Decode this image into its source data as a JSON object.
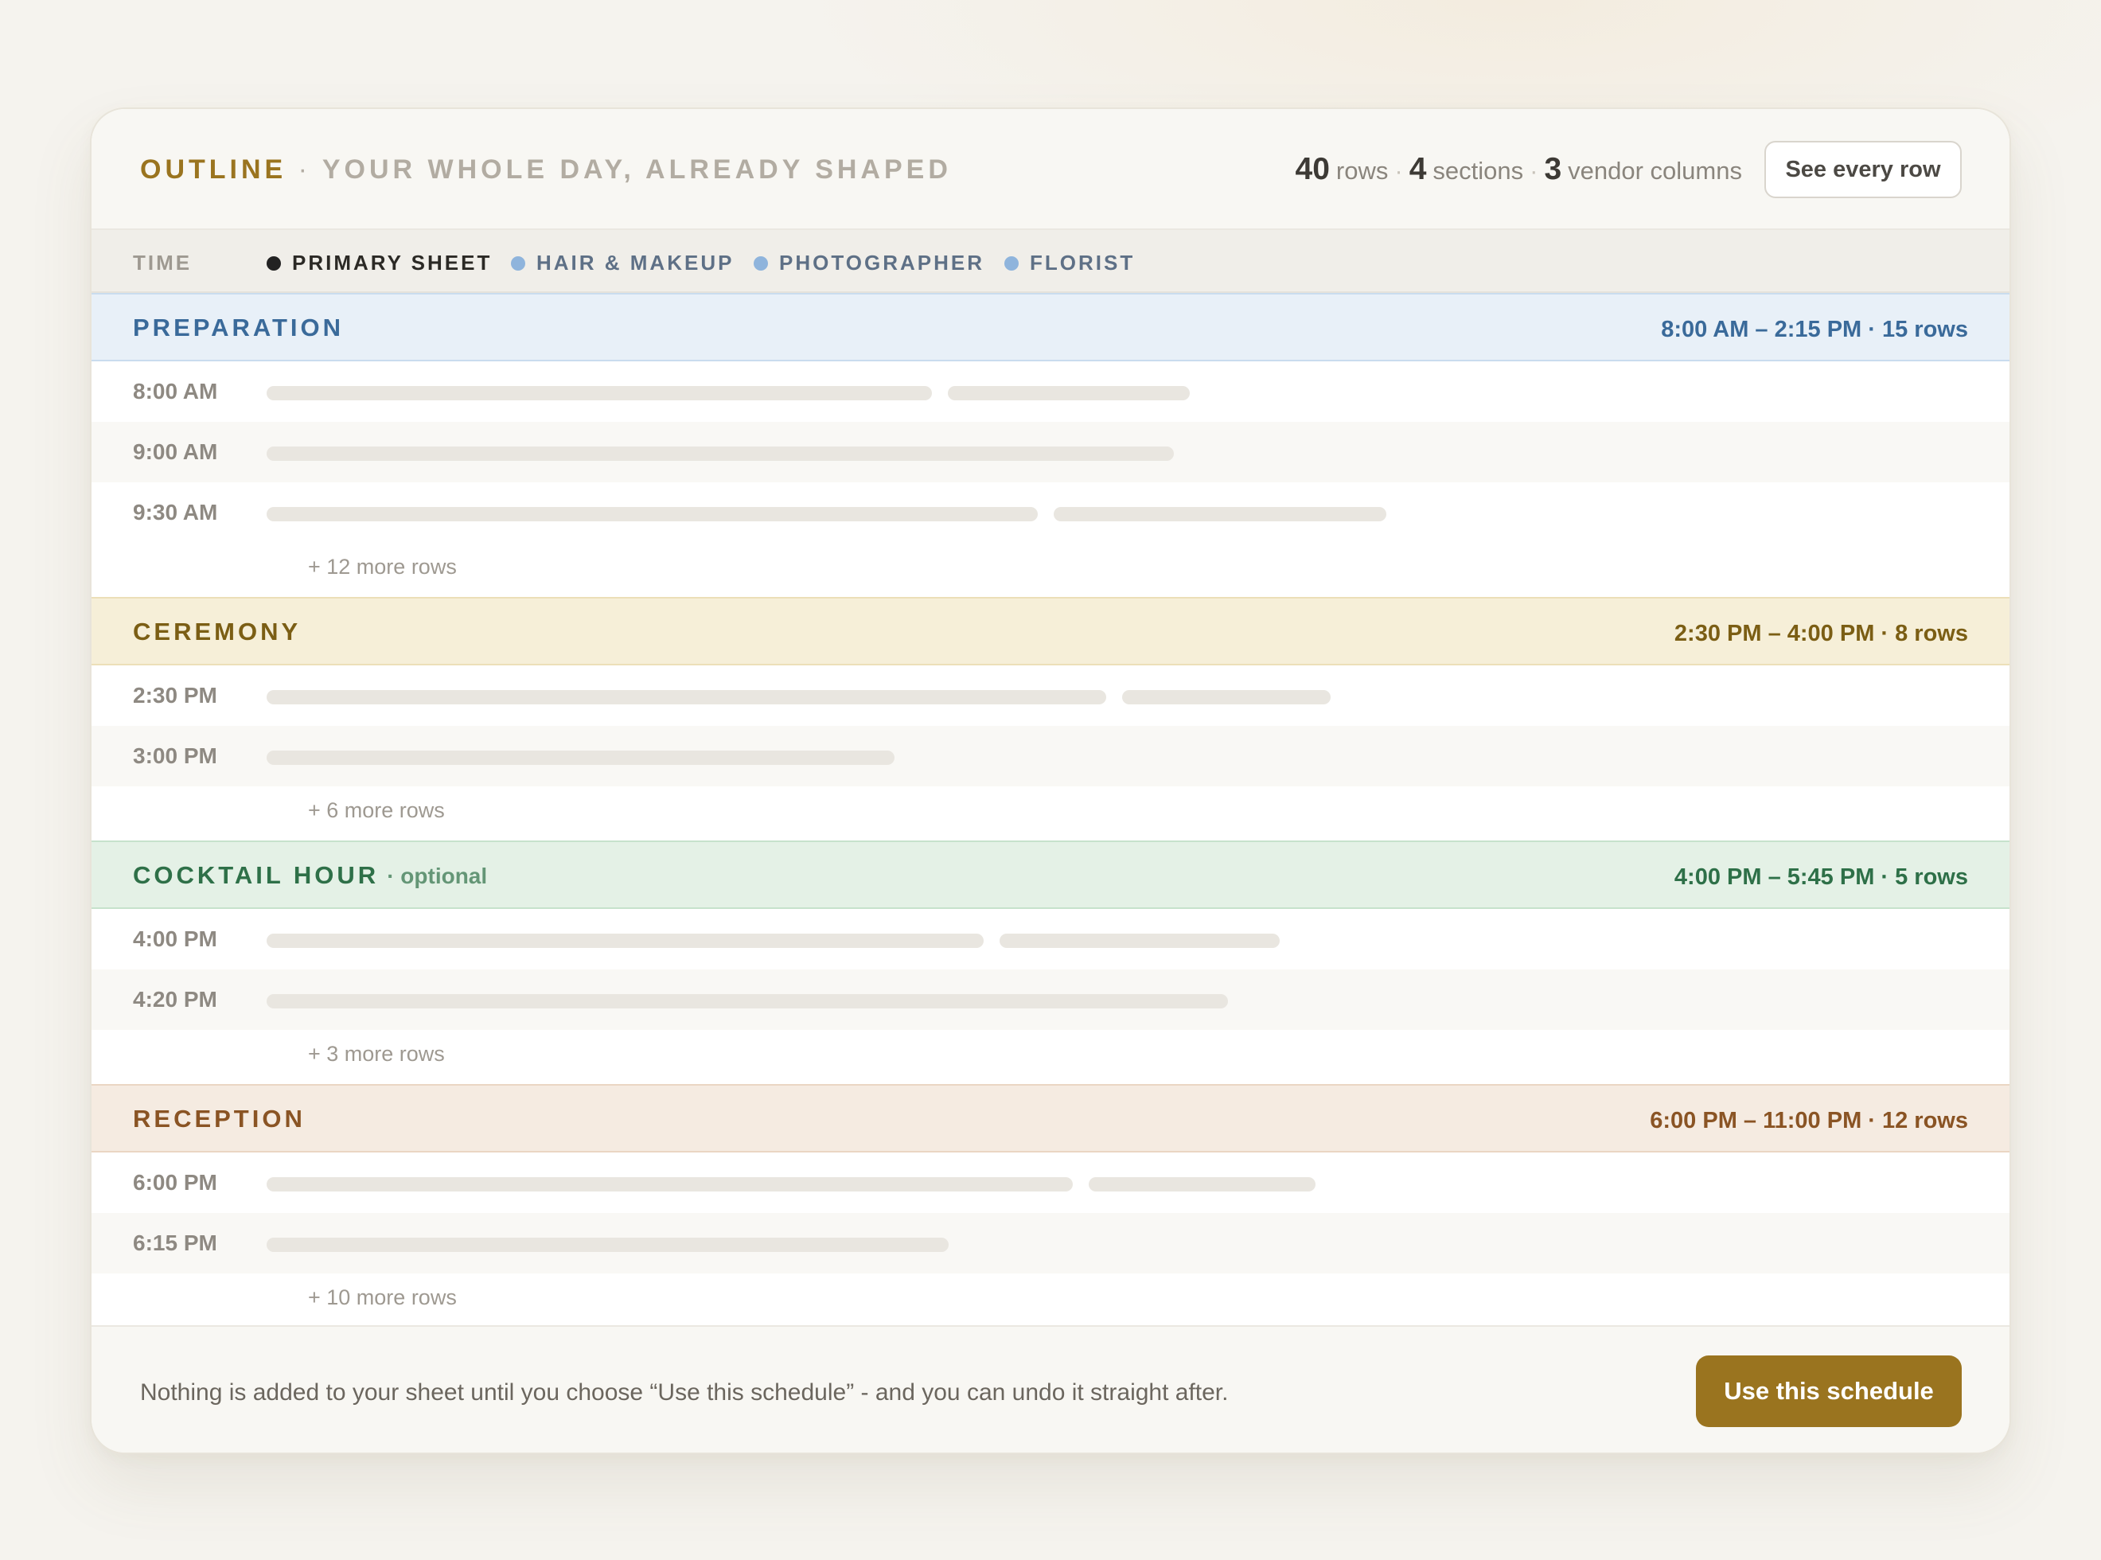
{
  "header": {
    "title_accent": "OUTLINE",
    "separator": "·",
    "subtitle": "YOUR WHOLE DAY, ALREADY SHAPED",
    "stats": {
      "rows_count": "40",
      "rows_label": "rows",
      "sections_count": "4",
      "sections_label": "sections",
      "vendor_count": "3",
      "vendor_label": "vendor columns",
      "dot": "·"
    },
    "see_every_row_label": "See every row"
  },
  "columns": {
    "time_label": "TIME",
    "legend": [
      {
        "label": "PRIMARY SHEET",
        "color": "#222222"
      },
      {
        "label": "HAIR & MAKEUP",
        "color": "#8fb4dc"
      },
      {
        "label": "PHOTOGRAPHER",
        "color": "#8fb4dc"
      },
      {
        "label": "FLORIST",
        "color": "#8fb4dc"
      }
    ]
  },
  "sections": [
    {
      "name": "PREPARATION",
      "optional": "",
      "range": "8:00 AM – 2:15 PM · 15 rows",
      "bg": "#e8f0f8",
      "border": "#c9dcee",
      "color": "#3a6a9a",
      "rows": [
        {
          "time": "8:00 AM",
          "bars": [
            0.44,
            0.16
          ]
        },
        {
          "time": "9:00 AM",
          "bars": [
            0.6
          ]
        },
        {
          "time": "9:30 AM",
          "bars": [
            0.51,
            0.22
          ]
        }
      ],
      "more": "+ 12 more rows"
    },
    {
      "name": "CEREMONY",
      "optional": "",
      "range": "2:30 PM – 4:00 PM · 8 rows",
      "bg": "#f6efd8",
      "border": "#ecdfb8",
      "color": "#7b5e14",
      "rows": [
        {
          "time": "2:30 PM",
          "bars": [
            0.555,
            0.138
          ]
        },
        {
          "time": "3:00 PM",
          "bars": [
            0.415
          ]
        }
      ],
      "more": "+ 6 more rows"
    },
    {
      "name": "COCKTAIL HOUR",
      "optional": "· optional",
      "range": "4:00 PM – 5:45 PM · 5 rows",
      "bg": "#e4f1e6",
      "border": "#c6e2cc",
      "color": "#2e7048",
      "rows": [
        {
          "time": "4:00 PM",
          "bars": [
            0.474,
            0.185
          ]
        },
        {
          "time": "4:20 PM",
          "bars": [
            0.636
          ]
        }
      ],
      "more": "+ 3 more rows"
    },
    {
      "name": "RECEPTION",
      "optional": "",
      "range": "6:00 PM – 11:00 PM · 12 rows",
      "bg": "#f5ebe1",
      "border": "#ead6c3",
      "color": "#8a5424",
      "rows": [
        {
          "time": "6:00 PM",
          "bars": [
            0.533,
            0.15
          ]
        },
        {
          "time": "6:15 PM",
          "bars": [
            0.451
          ]
        }
      ],
      "more": "+ 10 more rows"
    }
  ],
  "footer": {
    "note": "Nothing is added to your sheet until you choose “Use this schedule” - and you can undo it straight after.",
    "use_label": "Use this schedule"
  }
}
